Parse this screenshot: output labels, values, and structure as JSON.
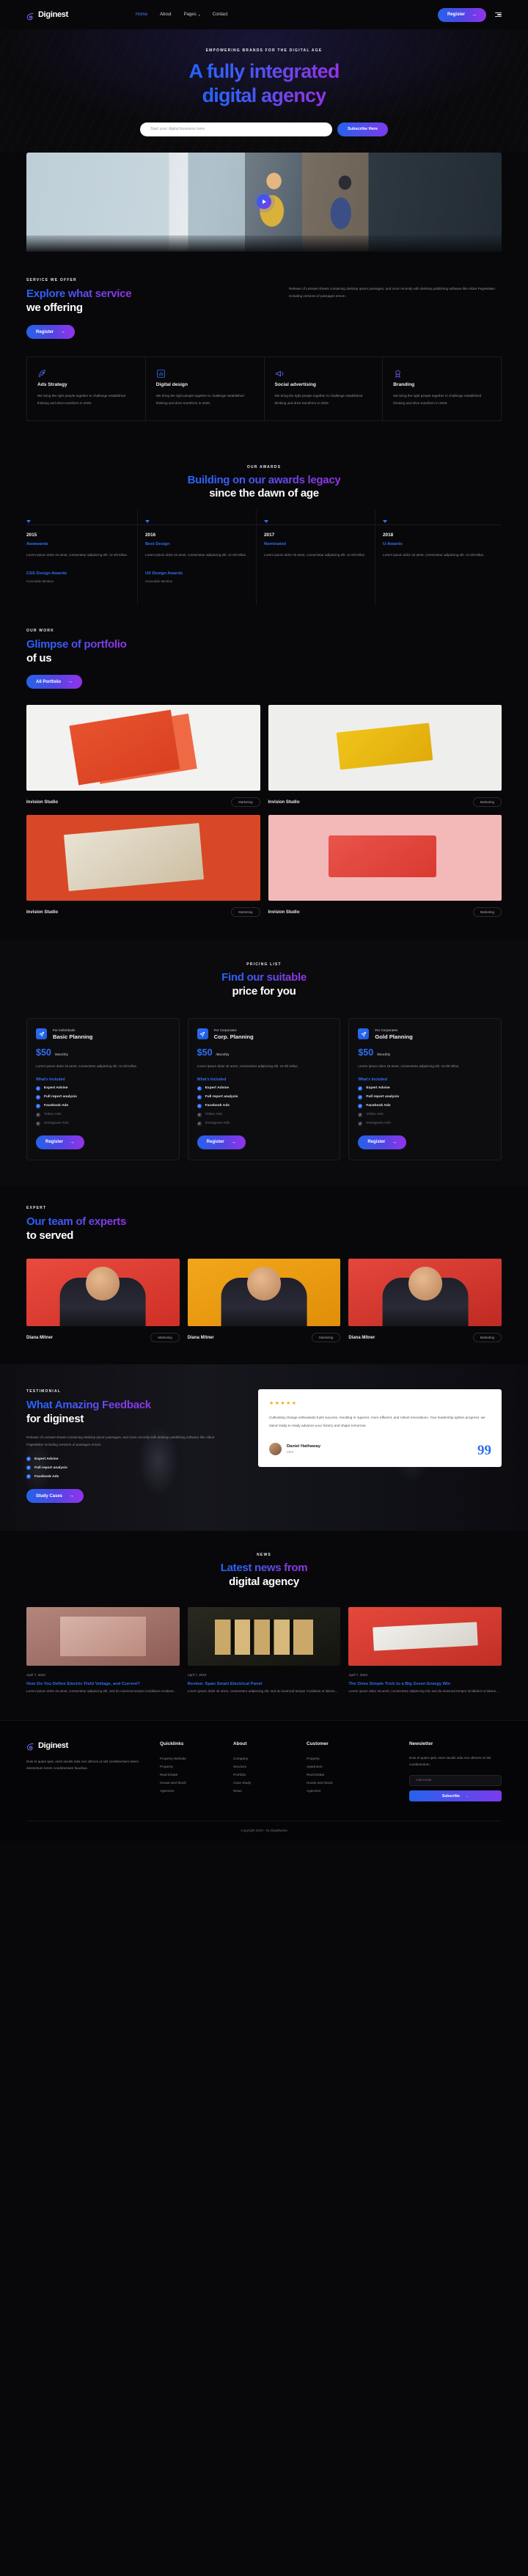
{
  "brand": {
    "name": "Diginest",
    "icon": "leaf-swirl-logo"
  },
  "nav": {
    "items": [
      {
        "label": "Home",
        "active": true
      },
      {
        "label": "About",
        "active": false
      },
      {
        "label": "Pages",
        "active": false,
        "caret": "▾"
      },
      {
        "label": "Contact",
        "active": false
      }
    ],
    "register_label": "Register",
    "arrow": "→",
    "menu_icon": "hamburger-icon"
  },
  "hero": {
    "eyebrow": "EMPOWERING BRANDS FOR THE DIGITAL AGE",
    "title_line1": "A fully integrated",
    "title_line2": "digital agency",
    "input_placeholder": "Start your digital business here",
    "subscribe_label": "Subscribe Here",
    "play_icon": "play-icon"
  },
  "services": {
    "eyebrow": "SERVICE WE OFFER",
    "title_line1": "Explore what service",
    "title_line2": "we offering",
    "paragraph": "Release of Letraset sheets containing desktop Ipsum passages, and more recently with desktop publishing software like Aldus PageMaker including versions of passages ersum.",
    "button_label": "Register",
    "arrow": "→",
    "cards": [
      {
        "icon": "rocket-icon",
        "title": "Ads Strategy",
        "text": "We bring the right people together to challenge established thinking and drive transform in 2020."
      },
      {
        "icon": "bar-chart-icon",
        "title": "Digital design",
        "text": "We bring the right people together to challenge established thinking and drive transform in 2020."
      },
      {
        "icon": "megaphone-icon",
        "title": "Social advertising",
        "text": "We bring the right people together to challenge established thinking and drive transform in 2020."
      },
      {
        "icon": "badge-icon",
        "title": "Branding",
        "text": "We bring the right people together to challenge established thinking and drive transform in 2020."
      }
    ]
  },
  "awards": {
    "eyebrow": "OUR AWARDS",
    "title_line1": "Building on our awards legacy",
    "title_line2": "since the dawn of age",
    "items": [
      {
        "year": "2015",
        "award": "Awwwards",
        "text": "Lorem ipsum dolor sit amet, consectetur adipiscing elit. Ut elit tellus.",
        "extra_title": "CSS Design Awards",
        "extra_sub": "Honorable Mention"
      },
      {
        "year": "2016",
        "award": "Best Design",
        "text": "Lorem ipsum dolor sit amet, consectetur adipiscing elit. Ut elit tellus.",
        "extra_title": "UX Design Awards",
        "extra_sub": "Honorable Mention"
      },
      {
        "year": "2017",
        "award": "Nominated",
        "text": "Lorem ipsum dolor sit amet, consectetur adipiscing elit. Ut elit tellus.",
        "extra_title": "",
        "extra_sub": ""
      },
      {
        "year": "2018",
        "award": "U-Awards",
        "text": "Lorem ipsum dolor sit amet, consectetur adipiscing elit. Ut elit tellus.",
        "extra_title": "",
        "extra_sub": ""
      }
    ]
  },
  "portfolio": {
    "eyebrow": "OUR WORK",
    "title_line1": "Glimpse of portfolio",
    "title_line2": "of us",
    "button_label": "All Portfolio",
    "arrow": "→",
    "items": [
      {
        "name": "Invision Studio",
        "tag": "Marketing"
      },
      {
        "name": "Invision Studio",
        "tag": "Marketing"
      },
      {
        "name": "Invision Studio",
        "tag": "Marketing"
      },
      {
        "name": "Invision Studio",
        "tag": "Marketing"
      }
    ]
  },
  "pricing": {
    "eyebrow": "PRICING LIST",
    "title_line1": "Find our suitable",
    "title_line2": "price for you",
    "plans": [
      {
        "icon": "paper-plane-icon",
        "audience": "For Individuals",
        "name": "Basic Planning",
        "price": "$50",
        "period": "/Monthly",
        "desc": "Lorem ipsum dolor sit amet, consectetur adipiscing elit. Ut elit tellus.",
        "included_label": "What's Included",
        "features": [
          {
            "label": "Expert Advise",
            "on": true
          },
          {
            "label": "Full report analysis",
            "on": true
          },
          {
            "label": "Facebook Ads",
            "on": true
          },
          {
            "label": "Video Ads",
            "on": false
          },
          {
            "label": "Instagram Ads",
            "on": false
          }
        ],
        "button_label": "Register"
      },
      {
        "icon": "paper-plane-icon",
        "audience": "For Corporates",
        "name": "Corp. Planning",
        "price": "$50",
        "period": "/Monthly",
        "desc": "Lorem ipsum dolor sit amet, consectetur adipiscing elit. Ut elit tellus.",
        "included_label": "What's Included",
        "features": [
          {
            "label": "Expert Advise",
            "on": true
          },
          {
            "label": "Full report analysis",
            "on": true
          },
          {
            "label": "Facebook Ads",
            "on": true
          },
          {
            "label": "Video Ads",
            "on": false
          },
          {
            "label": "Instagram Ads",
            "on": false
          }
        ],
        "button_label": "Register"
      },
      {
        "icon": "paper-plane-icon",
        "audience": "For Corporates",
        "name": "Gold Planning",
        "price": "$50",
        "period": "/Monthly",
        "desc": "Lorem ipsum dolor sit amet, consectetur adipiscing elit. Ut elit tellus.",
        "included_label": "What's Included",
        "features": [
          {
            "label": "Expert Advise",
            "on": true
          },
          {
            "label": "Full report analysis",
            "on": true
          },
          {
            "label": "Facebook Ads",
            "on": true
          },
          {
            "label": "Video Ads",
            "on": false
          },
          {
            "label": "Instagram Ads",
            "on": false
          }
        ],
        "button_label": "Register"
      }
    ]
  },
  "team": {
    "eyebrow": "EXPERT",
    "title_line1": "Our team of experts",
    "title_line2": "to served",
    "members": [
      {
        "name": "Diana Mitner",
        "tag": "Marketing"
      },
      {
        "name": "Diana Mitner",
        "tag": "Marketing"
      },
      {
        "name": "Diana Mitner",
        "tag": "Marketing"
      }
    ]
  },
  "testimonial": {
    "eyebrow": "TESTIMONIAL",
    "title_line1": "What Amazing Feedback",
    "title_line2": "for diginest",
    "paragraph": "Release of Letraset sheets containing desktop ipsum passages, and more recently with desktop publishing software like Aldus PageMaker including versions of passages ersum.",
    "features": [
      {
        "label": "Expert Advise"
      },
      {
        "label": "Full report analysis"
      },
      {
        "label": "Facebook Ads"
      }
    ],
    "button_label": "Study Cases",
    "arrow": "→",
    "stars": "★★★★★",
    "quote": "Cultivating change enthusiasts fuels success, resulting in superior, more efficient, and robust innovations. Your leadership ignites progress: we stand ready to ready advance your history and shape tomorrow.",
    "person_name": "Daniel Hathaway",
    "person_role": "CEO",
    "quote_mark": "99"
  },
  "news": {
    "eyebrow": "NEWS",
    "title_line1": "Latest news from",
    "title_line2": "digital agency",
    "posts": [
      {
        "date": "April 7, 2022",
        "title": "How Do You Define Electric Field Voltage, and Current?",
        "excerpt": "Lorem ipsum dolor sit amet, consectetur adipiscing elit, sed do eiusmod tempor incididunt ut labore..."
      },
      {
        "date": "April 7, 2022",
        "title": "Review: Span Smart Electrical Panel",
        "excerpt": "Lorem ipsum dolor sit amet, consectetur adipiscing elit, sed do eiusmod tempor incididunt ut labore..."
      },
      {
        "date": "April 7, 2022",
        "title": "The Ones Simple Trick to a Big Green Energy Win",
        "excerpt": "Lorem ipsum dolor sit amet, consectetur adipiscing elit, sed do eiusmod tempor incididunt ut labore..."
      }
    ]
  },
  "footer": {
    "brand": "Diginest",
    "about": "Duis et quam quis, enim iaculis odio non ultrices ut nisl condimentum lorem elementum lorem condimentum faucibus.",
    "columns": [
      {
        "heading": "Quicklinks",
        "items": [
          "Property Website",
          "Property",
          "Real Estate",
          "House and Stock",
          "Agencies"
        ]
      },
      {
        "heading": "About",
        "items": [
          "Company",
          "Services",
          "Portfolio",
          "Case Study",
          "News"
        ]
      },
      {
        "heading": "Customer",
        "items": [
          "Property",
          "Apartment",
          "Real Estate",
          "House and Stock",
          "Agencies"
        ]
      }
    ],
    "newsletter": {
      "heading": "Newsletter",
      "text": "Duis et quam quis, enim iaculis odio non ultrices ut nisl condimentum.",
      "input_placeholder": "Add email",
      "button_label": "Subscribe",
      "arrow": "→"
    },
    "copyright": "Copyright 2023 - by Digitalwinia"
  }
}
